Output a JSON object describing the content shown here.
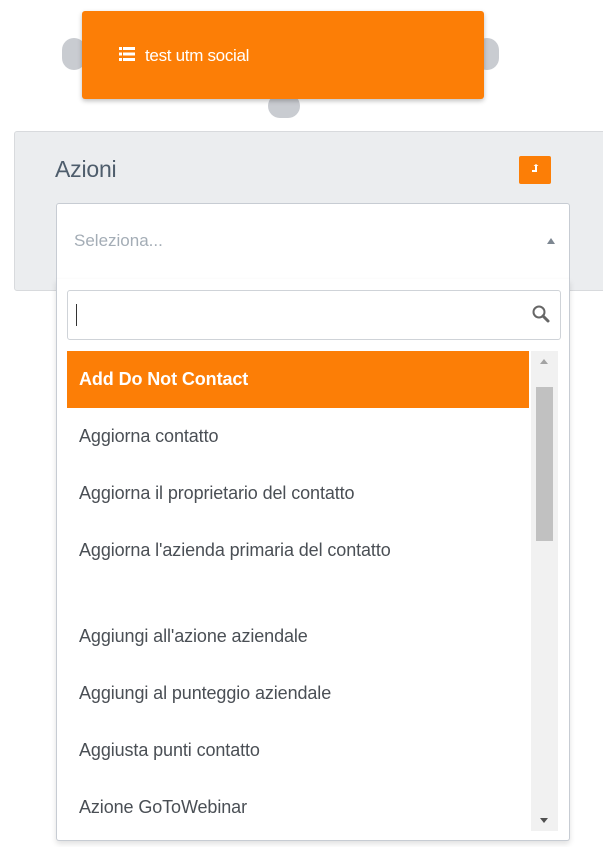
{
  "node": {
    "icon": "list-icon",
    "title": "test utm social",
    "color": "#fc7e06"
  },
  "panel": {
    "title": "Azioni",
    "action_icon": "expand-icon"
  },
  "select": {
    "placeholder": "Seleziona...",
    "arrow_icon": "caret-up-icon"
  },
  "search": {
    "value": "",
    "icon": "search-icon"
  },
  "options": [
    {
      "label": "Add Do Not Contact",
      "active": true
    },
    {
      "label": "Aggiorna contatto",
      "active": false
    },
    {
      "label": "Aggiorna il proprietario del contatto",
      "active": false
    },
    {
      "label": "Aggiorna l'azienda primaria del contatto",
      "active": false
    },
    {
      "label": "Aggiungi all'azione aziendale",
      "active": false
    },
    {
      "label": "Aggiungi al punteggio aziendale",
      "active": false
    },
    {
      "label": "Aggiusta punti contatto",
      "active": false
    },
    {
      "label": "Azione GoToWebinar",
      "active": false
    }
  ],
  "colors": {
    "accent": "#fc7e06",
    "text": "#4a4f55",
    "panel_bg": "#ebedef"
  }
}
